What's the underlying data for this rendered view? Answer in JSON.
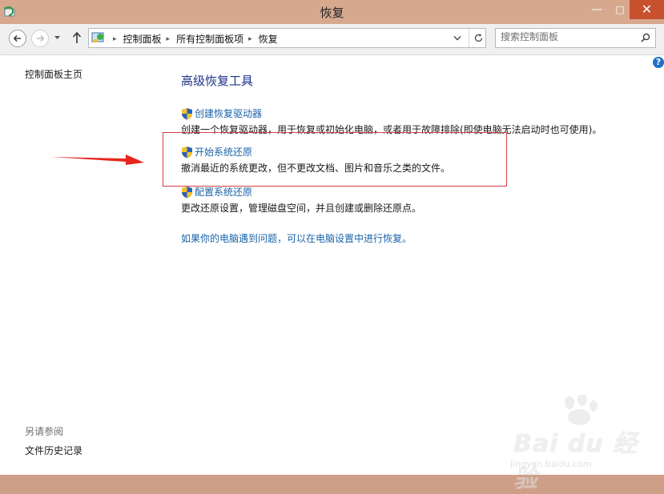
{
  "window": {
    "title": "恢复",
    "min_glyph": "—",
    "max_glyph": "□",
    "close_glyph": "✕"
  },
  "address_bar": {
    "crumbs": [
      "控制面板",
      "所有控制面板项",
      "恢复"
    ],
    "separator": "▸",
    "search_placeholder": "搜索控制面板"
  },
  "sidebar": {
    "home_link": "控制面板主页",
    "see_also_label": "另请参阅",
    "file_history_link": "文件历史记录"
  },
  "main": {
    "heading": "高级恢复工具",
    "tasks": [
      {
        "title": "创建恢复驱动器",
        "description": "创建一个恢复驱动器，用于恢复或初始化电脑，或者用于故障排除(即使电脑无法启动时也可使用)。"
      },
      {
        "title": "开始系统还原",
        "description": "撤消最近的系统更改，但不更改文档、图片和音乐之类的文件。"
      },
      {
        "title": "配置系统还原",
        "description": "更改还原设置，管理磁盘空间，并且创建或删除还原点。"
      }
    ],
    "bottom_link": "如果你的电脑遇到问题，可以在电脑设置中进行恢复。",
    "help_glyph": "?"
  },
  "watermark": {
    "brand": "Bai du 经验",
    "sub": "jingyan.baidu.com"
  },
  "colors": {
    "titlebar": "#d6a98f",
    "close_button": "#c7502f",
    "link": "#1b63a8",
    "heading": "#1e3287",
    "highlight": "#d64040"
  }
}
